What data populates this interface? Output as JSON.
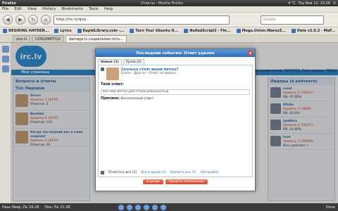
{
  "window": {
    "app": "Firefox",
    "title": "Ответы - Mozilla Firefox",
    "clock": "Пщ Янв 12, 23:28",
    "temp": "4 °C"
  },
  "menu": [
    "File",
    "Edit",
    "View",
    "History",
    "Bookmarks",
    "Tools",
    "Help"
  ],
  "nav": {
    "url": "http://irc.lv/qna",
    "search_placeholder": "Google"
  },
  "bookmarks": [
    "DESIRING HAYDEN...",
    "Lyrics",
    "RapidLibrary.com -...",
    "Turn Your Ubuntu H...",
    "NulledScript2 - Fin...",
    "Mega.Union.WarezZ...",
    "Ifate v2.0.3 - MaF..."
  ],
  "tabs": [
    "one.lv",
    "COOLPARTY.LV",
    "damage.lv социальная сеть..."
  ],
  "site": {
    "logo": "irc.lv",
    "my_page": "Моя страница",
    "stats": "Пользователей: 3464951, Участников: 78519",
    "online": "онлайн: 744",
    "date": "12. января 23:17"
  },
  "left": {
    "section": "Вопросы и ответы",
    "top_title": "Топ Лидеров",
    "items": [
      {
        "user": "Drone",
        "level": "Уровень 1 (4470)",
        "meta": "Ответов: 2"
      },
      {
        "user": "Burdaki",
        "level": "Уровень 4 (4470)",
        "meta": "Ответов: 119"
      },
      {
        "user": "Когда последний раз в кине ходили?",
        "level": "Уровень 1 (4670)",
        "meta": "Ответов: 16"
      }
    ]
  },
  "right": {
    "section": "Лидеры (в рейтинге)",
    "items": [
      {
        "user": "ovad",
        "level": "Уровень 5 (36547)",
        "meta": "RB: 47.00%"
      },
      {
        "user": "Ufolla",
        "level": "Уровень 5 (3698)",
        "meta": "RB: 43.9%"
      },
      {
        "user": "spakers",
        "level": "Уровень 4 (56225)",
        "meta": "RB: 43.89%"
      },
      {
        "user": "Ivan",
        "level": "Уровень 7 (90948)",
        "meta": "Весь рейтинг »"
      }
    ]
  },
  "modal": {
    "title": "Последние события: Ответ удален",
    "close": "x",
    "tabs": [
      "Новые (1)",
      "Архив (0)"
    ],
    "question": "Сколько стоят ваши мечты?",
    "q_sub": "Drone · Другое · Ответ на вопрос",
    "answer_label": "Твой ответ:",
    "answer": "все мои мечты уже стали реальностью",
    "reason_label": "Причина:",
    "reason": "Бесполезный ответ.",
    "footer": {
      "select_all": "Отметить все (1)",
      "archive": "Все в архив (1)",
      "delete": "Удалить все (1)",
      "settings": "Настройки"
    },
    "buttons": [
      "В архив",
      "Удалить отмеченные"
    ]
  },
  "status": {
    "left": "Наш-Лиер, Пк 16:28",
    "mid": "Пон: Пк 21:28",
    "done": "Done"
  }
}
